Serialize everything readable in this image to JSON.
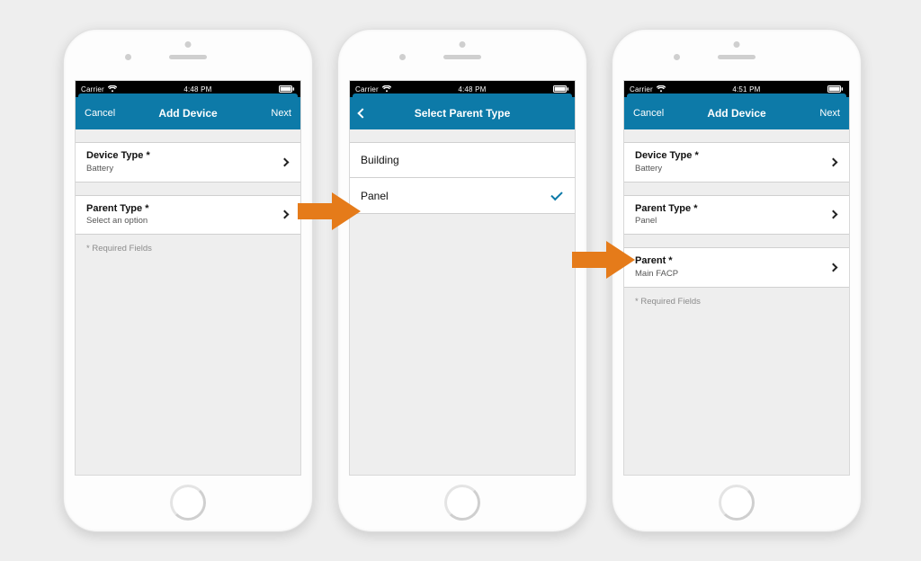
{
  "statusbar": {
    "carrier": "Carrier",
    "time_a": "4:48 PM",
    "time_b": "4:48 PM",
    "time_c": "4:51 PM"
  },
  "phone1": {
    "header": {
      "left": "Cancel",
      "title": "Add Device",
      "right": "Next"
    },
    "rows": {
      "device_type": {
        "label": "Device Type *",
        "value": "Battery"
      },
      "parent_type": {
        "label": "Parent Type *",
        "value": "Select an option"
      }
    },
    "hint": "* Required Fields"
  },
  "phone2": {
    "header": {
      "title": "Select Parent Type"
    },
    "options": {
      "building": "Building",
      "panel": "Panel",
      "selected": "panel"
    }
  },
  "phone3": {
    "header": {
      "left": "Cancel",
      "title": "Add Device",
      "right": "Next"
    },
    "rows": {
      "device_type": {
        "label": "Device Type *",
        "value": "Battery"
      },
      "parent_type": {
        "label": "Parent Type *",
        "value": "Panel"
      },
      "parent": {
        "label": "Parent *",
        "value": "Main FACP"
      }
    },
    "hint": "* Required Fields"
  }
}
